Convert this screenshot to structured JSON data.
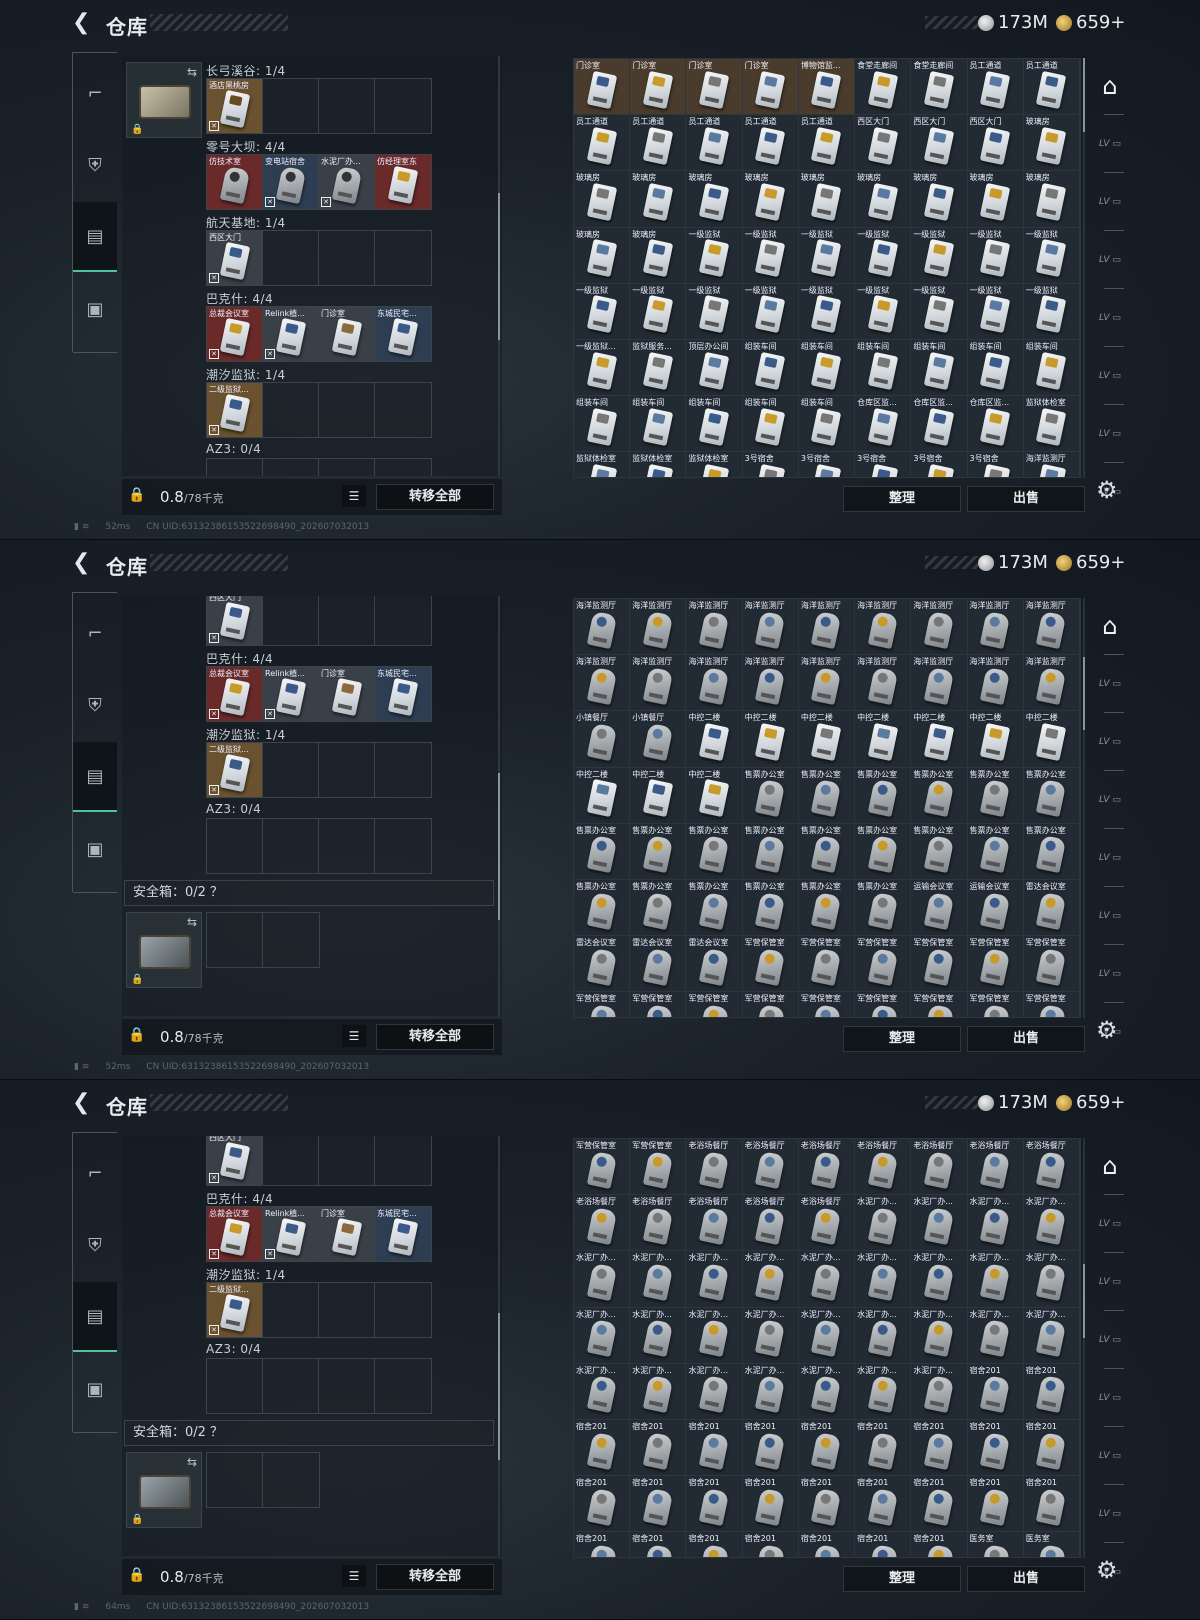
{
  "header": {
    "back_icon": "back-arrow-icon",
    "title": "仓库",
    "silver_amount": "173M",
    "gold_amount": "659+"
  },
  "status": {
    "uid": "CN UID:631323861535226984​90_202607032013"
  },
  "transfer_all": "转移全部",
  "sort_label": "整理",
  "sell_label": "出售",
  "weight_value": "0.8",
  "weight_unit": "/78千克",
  "safe_box_label": "安全箱：0/2 ？",
  "side_tabs": [
    "gun-icon",
    "armor-icon",
    "keycard-case-icon",
    "briefcase-icon"
  ],
  "right_tabs": [
    "home-icon",
    "lv5-card-icon",
    "lv4-card-icon",
    "lv3-card-icon",
    "lv2-card-icon",
    "lv1-card-icon",
    "lv0-card-icon",
    "lv-misc-card-icon"
  ],
  "panels": [
    {
      "ping": "52ms",
      "left_scroll": {
        "pos": 0.5,
        "size": 0.35
      },
      "right_scroll": {
        "pos": 0.0,
        "size": 0.35
      },
      "left_sections": [
        {
          "label": "长弓溪谷: 1/4",
          "partial_top": true,
          "cells": [
            {
              "name": "酒店黑桃房",
              "kind": "card",
              "tint": "gold",
              "strip": "#6a4a20",
              "warn": true
            }
          ]
        },
        {
          "label": "零号大坝: 4/4",
          "cells": [
            {
              "name": "仿技术室",
              "kind": "key",
              "tint": "red",
              "warn": false
            },
            {
              "name": "变电站宿舍",
              "kind": "key",
              "tint": "blue",
              "warn": true
            },
            {
              "name": "水泥厂办...",
              "kind": "key",
              "tint": "grey",
              "warn": true
            },
            {
              "name": "仿经理室东",
              "kind": "card",
              "tint": "red",
              "strip": "#c79a2a",
              "warn": false
            }
          ]
        },
        {
          "label": "航天基地: 1/4",
          "cells": [
            {
              "name": "西区大门",
              "kind": "card",
              "tint": "grey",
              "strip": "#3a5a8a",
              "warn": true
            }
          ]
        },
        {
          "label": "巴克什: 4/4",
          "cells": [
            {
              "name": "总裁会议室",
              "kind": "card",
              "tint": "red",
              "strip": "#c79a2a",
              "warn": true
            },
            {
              "name": "Relink植...",
              "kind": "card",
              "tint": "grey",
              "strip": "#3a5a8a",
              "warn": true
            },
            {
              "name": "门诊室",
              "kind": "card",
              "tint": "grey",
              "strip": "#8a6a3a",
              "warn": false
            },
            {
              "name": "东城民宅...",
              "kind": "card",
              "tint": "blue",
              "strip": "#3a5a8a",
              "warn": false
            }
          ]
        },
        {
          "label": "潮汐监狱: 1/4",
          "cells": [
            {
              "name": "二级监狱...",
              "kind": "card",
              "tint": "gold",
              "strip": "#3a5a8a",
              "warn": true
            }
          ]
        },
        {
          "label": "AZ3: 0/4",
          "cells": []
        }
      ],
      "right_rows": [
        [
          [
            "门诊室",
            "o"
          ],
          [
            "门诊室",
            "o"
          ],
          [
            "门诊室",
            "o"
          ],
          [
            "门诊室",
            "o"
          ],
          [
            "博物馆监...",
            "o"
          ],
          [
            "食堂走廊间",
            ""
          ],
          [
            "食堂走廊间",
            ""
          ],
          [
            "员工通道",
            ""
          ],
          [
            "员工通道",
            ""
          ]
        ],
        [
          [
            "员工通道",
            ""
          ],
          [
            "员工通道",
            ""
          ],
          [
            "员工通道",
            ""
          ],
          [
            "员工通道",
            ""
          ],
          [
            "员工通道",
            ""
          ],
          [
            "西区大门",
            ""
          ],
          [
            "西区大门",
            ""
          ],
          [
            "西区大门",
            ""
          ],
          [
            "玻璃房",
            ""
          ]
        ],
        [
          [
            "玻璃房",
            ""
          ],
          [
            "玻璃房",
            ""
          ],
          [
            "玻璃房",
            ""
          ],
          [
            "玻璃房",
            ""
          ],
          [
            "玻璃房",
            ""
          ],
          [
            "玻璃房",
            ""
          ],
          [
            "玻璃房",
            ""
          ],
          [
            "玻璃房",
            ""
          ],
          [
            "玻璃房",
            ""
          ]
        ],
        [
          [
            "玻璃房",
            ""
          ],
          [
            "玻璃房",
            ""
          ],
          [
            "一级监狱",
            ""
          ],
          [
            "一级监狱",
            ""
          ],
          [
            "一级监狱",
            ""
          ],
          [
            "一级监狱",
            ""
          ],
          [
            "一级监狱",
            ""
          ],
          [
            "一级监狱",
            ""
          ],
          [
            "一级监狱",
            ""
          ]
        ],
        [
          [
            "一级监狱",
            ""
          ],
          [
            "一级监狱",
            ""
          ],
          [
            "一级监狱",
            ""
          ],
          [
            "一级监狱",
            ""
          ],
          [
            "一级监狱",
            ""
          ],
          [
            "一级监狱",
            ""
          ],
          [
            "一级监狱",
            ""
          ],
          [
            "一级监狱",
            ""
          ],
          [
            "一级监狱",
            ""
          ]
        ],
        [
          [
            "一级监狱...",
            ""
          ],
          [
            "监狱服务...",
            ""
          ],
          [
            "顶层办公间",
            ""
          ],
          [
            "组装车间",
            ""
          ],
          [
            "组装车间",
            ""
          ],
          [
            "组装车间",
            ""
          ],
          [
            "组装车间",
            ""
          ],
          [
            "组装车间",
            ""
          ],
          [
            "组装车间",
            ""
          ]
        ],
        [
          [
            "组装车间",
            ""
          ],
          [
            "组装车间",
            ""
          ],
          [
            "组装车间",
            ""
          ],
          [
            "组装车间",
            ""
          ],
          [
            "组装车间",
            ""
          ],
          [
            "仓库区监...",
            ""
          ],
          [
            "仓库区监...",
            ""
          ],
          [
            "仓库区监...",
            ""
          ],
          [
            "监狱体检室",
            ""
          ]
        ],
        [
          [
            "监狱体检室",
            ""
          ],
          [
            "监狱体检室",
            ""
          ],
          [
            "监狱体检室",
            ""
          ],
          [
            "3号宿舍",
            ""
          ],
          [
            "3号宿舍",
            ""
          ],
          [
            "3号宿舍",
            ""
          ],
          [
            "3号宿舍",
            ""
          ],
          [
            "3号宿舍",
            ""
          ],
          [
            "海洋监测厅",
            ""
          ]
        ]
      ]
    },
    {
      "ping": "52ms",
      "left_scroll": {
        "pos": 0.65,
        "size": 0.35
      },
      "right_scroll": {
        "pos": 0.14,
        "size": 0.35
      },
      "right_rows": [
        [
          [
            "海洋监测厅",
            ""
          ],
          [
            "海洋监测厅",
            ""
          ],
          [
            "海洋监测厅",
            ""
          ],
          [
            "海洋监测厅",
            ""
          ],
          [
            "海洋监测厅",
            ""
          ],
          [
            "海洋监测厅",
            ""
          ],
          [
            "海洋监测厅",
            ""
          ],
          [
            "海洋监测厅",
            ""
          ],
          [
            "海洋监测厅",
            ""
          ]
        ],
        [
          [
            "海洋监测厅",
            ""
          ],
          [
            "海洋监测厅",
            ""
          ],
          [
            "海洋监测厅",
            ""
          ],
          [
            "海洋监测厅",
            ""
          ],
          [
            "海洋监测厅",
            ""
          ],
          [
            "海洋监测厅",
            ""
          ],
          [
            "海洋监测厅",
            ""
          ],
          [
            "海洋监测厅",
            ""
          ],
          [
            "海洋监测厅",
            ""
          ]
        ],
        [
          [
            "小镇餐厅",
            ""
          ],
          [
            "小镇餐厅",
            ""
          ],
          [
            "中控二楼",
            ""
          ],
          [
            "中控二楼",
            ""
          ],
          [
            "中控二楼",
            ""
          ],
          [
            "中控二楼",
            ""
          ],
          [
            "中控二楼",
            ""
          ],
          [
            "中控二楼",
            ""
          ],
          [
            "中控二楼",
            ""
          ]
        ],
        [
          [
            "中控二楼",
            ""
          ],
          [
            "中控二楼",
            ""
          ],
          [
            "中控二楼",
            ""
          ],
          [
            "售票办公室",
            ""
          ],
          [
            "售票办公室",
            ""
          ],
          [
            "售票办公室",
            ""
          ],
          [
            "售票办公室",
            ""
          ],
          [
            "售票办公室",
            ""
          ],
          [
            "售票办公室",
            ""
          ]
        ],
        [
          [
            "售票办公室",
            ""
          ],
          [
            "售票办公室",
            ""
          ],
          [
            "售票办公室",
            ""
          ],
          [
            "售票办公室",
            ""
          ],
          [
            "售票办公室",
            ""
          ],
          [
            "售票办公室",
            ""
          ],
          [
            "售票办公室",
            ""
          ],
          [
            "售票办公室",
            ""
          ],
          [
            "售票办公室",
            ""
          ]
        ],
        [
          [
            "售票办公室",
            ""
          ],
          [
            "售票办公室",
            ""
          ],
          [
            "售票办公室",
            ""
          ],
          [
            "售票办公室",
            ""
          ],
          [
            "售票办公室",
            ""
          ],
          [
            "售票办公室",
            ""
          ],
          [
            "运输会议室",
            ""
          ],
          [
            "运输会议室",
            ""
          ],
          [
            "雷达会议室",
            ""
          ]
        ],
        [
          [
            "雷达会议室",
            ""
          ],
          [
            "雷达会议室",
            ""
          ],
          [
            "雷达会议室",
            ""
          ],
          [
            "军营保管室",
            ""
          ],
          [
            "军营保管室",
            ""
          ],
          [
            "军营保管室",
            ""
          ],
          [
            "军营保管室",
            ""
          ],
          [
            "军营保管室",
            ""
          ],
          [
            "军营保管室",
            ""
          ]
        ],
        [
          [
            "军营保管室",
            ""
          ],
          [
            "军营保管室",
            ""
          ],
          [
            "军营保管室",
            ""
          ],
          [
            "军营保管室",
            ""
          ],
          [
            "军营保管室",
            ""
          ],
          [
            "军营保管室",
            ""
          ],
          [
            "军营保管室",
            ""
          ],
          [
            "军营保管室",
            ""
          ],
          [
            "军营保管室",
            ""
          ]
        ]
      ]
    },
    {
      "ping": "64ms",
      "left_scroll": {
        "pos": 0.65,
        "size": 0.35
      },
      "right_scroll": {
        "pos": 0.3,
        "size": 0.35
      },
      "right_rows": [
        [
          [
            "军营保管室",
            ""
          ],
          [
            "军营保管室",
            ""
          ],
          [
            "老浴场餐厅",
            ""
          ],
          [
            "老浴场餐厅",
            ""
          ],
          [
            "老浴场餐厅",
            ""
          ],
          [
            "老浴场餐厅",
            ""
          ],
          [
            "老浴场餐厅",
            ""
          ],
          [
            "老浴场餐厅",
            ""
          ],
          [
            "老浴场餐厅",
            ""
          ]
        ],
        [
          [
            "老浴场餐厅",
            ""
          ],
          [
            "老浴场餐厅",
            ""
          ],
          [
            "老浴场餐厅",
            ""
          ],
          [
            "老浴场餐厅",
            ""
          ],
          [
            "老浴场餐厅",
            ""
          ],
          [
            "水泥厂办...",
            ""
          ],
          [
            "水泥厂办...",
            ""
          ],
          [
            "水泥厂办...",
            ""
          ],
          [
            "水泥厂办...",
            ""
          ]
        ],
        [
          [
            "水泥厂办...",
            ""
          ],
          [
            "水泥厂办...",
            ""
          ],
          [
            "水泥厂办...",
            ""
          ],
          [
            "水泥厂办...",
            ""
          ],
          [
            "水泥厂办...",
            ""
          ],
          [
            "水泥厂办...",
            ""
          ],
          [
            "水泥厂办...",
            ""
          ],
          [
            "水泥厂办...",
            ""
          ],
          [
            "水泥厂办...",
            ""
          ]
        ],
        [
          [
            "水泥厂办...",
            ""
          ],
          [
            "水泥厂办...",
            ""
          ],
          [
            "水泥厂办...",
            ""
          ],
          [
            "水泥厂办...",
            ""
          ],
          [
            "水泥厂办...",
            ""
          ],
          [
            "水泥厂办...",
            ""
          ],
          [
            "水泥厂办...",
            ""
          ],
          [
            "水泥厂办...",
            ""
          ],
          [
            "水泥厂办...",
            ""
          ]
        ],
        [
          [
            "水泥厂办...",
            ""
          ],
          [
            "水泥厂办...",
            ""
          ],
          [
            "水泥厂办...",
            ""
          ],
          [
            "水泥厂办...",
            ""
          ],
          [
            "水泥厂办...",
            ""
          ],
          [
            "水泥厂办...",
            ""
          ],
          [
            "水泥厂办...",
            ""
          ],
          [
            "宿舍201",
            ""
          ],
          [
            "宿舍201",
            ""
          ]
        ],
        [
          [
            "宿舍201",
            ""
          ],
          [
            "宿舍201",
            ""
          ],
          [
            "宿舍201",
            ""
          ],
          [
            "宿舍201",
            ""
          ],
          [
            "宿舍201",
            ""
          ],
          [
            "宿舍201",
            ""
          ],
          [
            "宿舍201",
            ""
          ],
          [
            "宿舍201",
            ""
          ],
          [
            "宿舍201",
            ""
          ]
        ],
        [
          [
            "宿舍201",
            ""
          ],
          [
            "宿舍201",
            ""
          ],
          [
            "宿舍201",
            ""
          ],
          [
            "宿舍201",
            ""
          ],
          [
            "宿舍201",
            ""
          ],
          [
            "宿舍201",
            ""
          ],
          [
            "宿舍201",
            ""
          ],
          [
            "宿舍201",
            ""
          ],
          [
            "宿舍201",
            ""
          ]
        ],
        [
          [
            "宿舍201",
            ""
          ],
          [
            "宿舍201",
            ""
          ],
          [
            "宿舍201",
            ""
          ],
          [
            "宿舍201",
            ""
          ],
          [
            "宿舍201",
            ""
          ],
          [
            "宿舍201",
            ""
          ],
          [
            "宿舍201",
            ""
          ],
          [
            "医务室",
            ""
          ],
          [
            "医务室",
            ""
          ]
        ]
      ]
    }
  ],
  "lower_left_sections": [
    {
      "label": "巴克什: 4/4",
      "cells": [
        {
          "name": "总裁会议室",
          "kind": "card",
          "tint": "red",
          "strip": "#c79a2a",
          "warn": true
        },
        {
          "name": "Relink植...",
          "kind": "card",
          "tint": "grey",
          "strip": "#3a5a8a",
          "warn": true
        },
        {
          "name": "门诊室",
          "kind": "card",
          "tint": "grey",
          "strip": "#8a6a3a",
          "warn": false
        },
        {
          "name": "东城民宅...",
          "kind": "card",
          "tint": "blue",
          "strip": "#3a5a8a",
          "warn": false
        }
      ]
    },
    {
      "label": "潮汐监狱: 1/4",
      "cells": [
        {
          "name": "二级监狱...",
          "kind": "card",
          "tint": "gold",
          "strip": "#3a5a8a",
          "warn": true
        }
      ]
    },
    {
      "label": "AZ3: 0/4",
      "cells": []
    }
  ],
  "partial_top_cell": {
    "name": "西区大门",
    "kind": "card",
    "tint": "grey",
    "strip": "#3a5a8a",
    "warn": true
  }
}
